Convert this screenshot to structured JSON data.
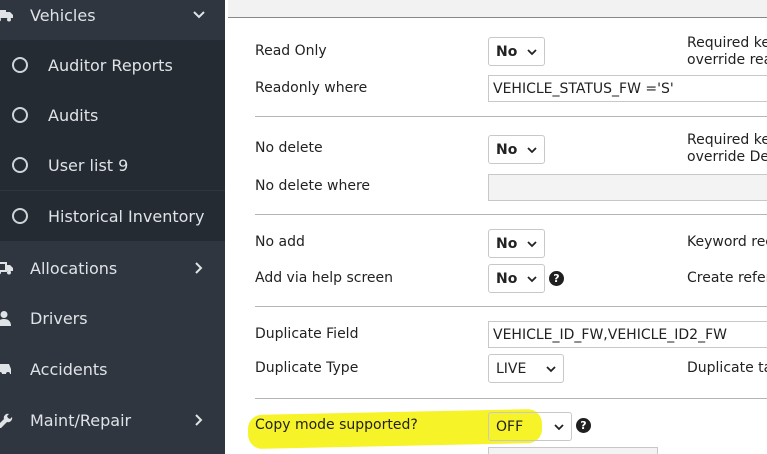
{
  "sidebar": {
    "vehicles": {
      "label": "Vehicles",
      "icon": "truck-icon"
    },
    "sub_items": [
      {
        "label": "Auditor Reports"
      },
      {
        "label": "Audits"
      },
      {
        "label": "User list 9"
      },
      {
        "label": "Historical Inventory"
      }
    ],
    "allocations": {
      "label": "Allocations",
      "icon": "truck-arrow-icon"
    },
    "drivers": {
      "label": "Drivers",
      "icon": "user-icon"
    },
    "accidents": {
      "label": "Accidents",
      "icon": "car-crash-icon"
    },
    "maint": {
      "label": "Maint/Repair",
      "icon": "wrench-icon"
    }
  },
  "form": {
    "read_only": {
      "label": "Read Only",
      "value": "No"
    },
    "readonly_where": {
      "label": "Readonly where",
      "value": "VEHICLE_STATUS_FW ='S'"
    },
    "required_key_1": "Required ke",
    "override_read": "override rea",
    "no_delete": {
      "label": "No delete",
      "value": "No"
    },
    "no_delete_where": {
      "label": "No delete where",
      "value": ""
    },
    "required_key_2": "Required ke",
    "override_delete": "override Del",
    "no_add": {
      "label": "No add",
      "value": "No"
    },
    "keyword_req": "Keyword rec",
    "add_via_help": {
      "label": "Add via help screen",
      "value": "No"
    },
    "create_ref": "Create refer",
    "duplicate_field": {
      "label": "Duplicate Field",
      "value": "VEHICLE_ID_FW,VEHICLE_ID2_FW"
    },
    "duplicate_type": {
      "label": "Duplicate Type",
      "value": "LIVE"
    },
    "duplicate_ta": "Duplicate ta",
    "copy_mode": {
      "label": "Copy mode supported?",
      "value": "OFF"
    }
  },
  "colors": {
    "sidebar_bg": "#2f3640",
    "sub_bg": "#252b33",
    "highlight": "#f6f21d"
  }
}
